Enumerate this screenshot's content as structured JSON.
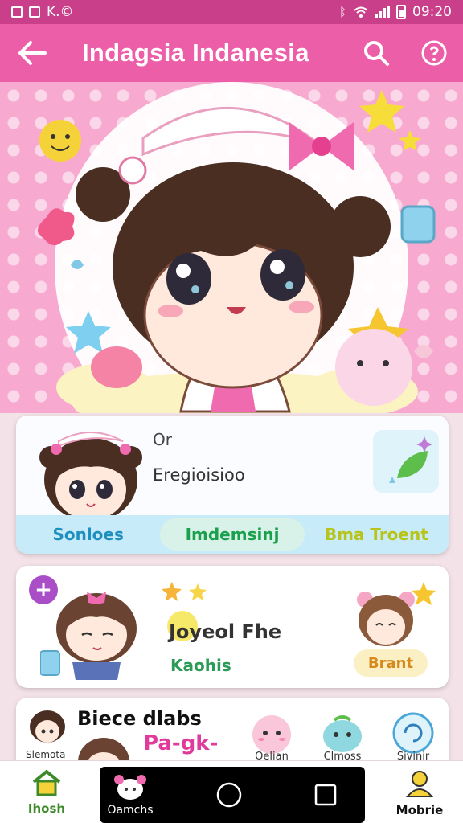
{
  "status_bar": {
    "left_text": "K.©",
    "time": "09:20"
  },
  "app_bar": {
    "title": "Indagsia Indanesia",
    "icons": [
      "back-arrow-icon",
      "search-icon",
      "info-icon"
    ]
  },
  "colors": {
    "status_bar": "#c93f8a",
    "app_bar": "#ec5fa8",
    "hero_bg": "#f7a9cf",
    "tab_bar": "#c7ebf9"
  },
  "profile_card": {
    "line1": "Or",
    "line2": "Eregioisioo",
    "tabs": [
      {
        "label": "Sonloes"
      },
      {
        "label": "Imdemsinj"
      },
      {
        "label": "Bma Troent"
      }
    ]
  },
  "feature_card": {
    "heading": "Joyeol Fhe",
    "subheading": "Kaohis",
    "badge": "Brant"
  },
  "list_card": {
    "heading": "Biece dlabs",
    "pink_text": "Pa-gk-",
    "small_label": "Slemota",
    "items": [
      {
        "label": "Oelian"
      },
      {
        "label": "Clmoss"
      },
      {
        "label": "Sivinir"
      }
    ]
  },
  "bottom_nav": {
    "left": {
      "label": "Ihosh"
    },
    "thumb": {
      "label": "Oamchs"
    },
    "right": {
      "label": "Mobrie"
    }
  }
}
